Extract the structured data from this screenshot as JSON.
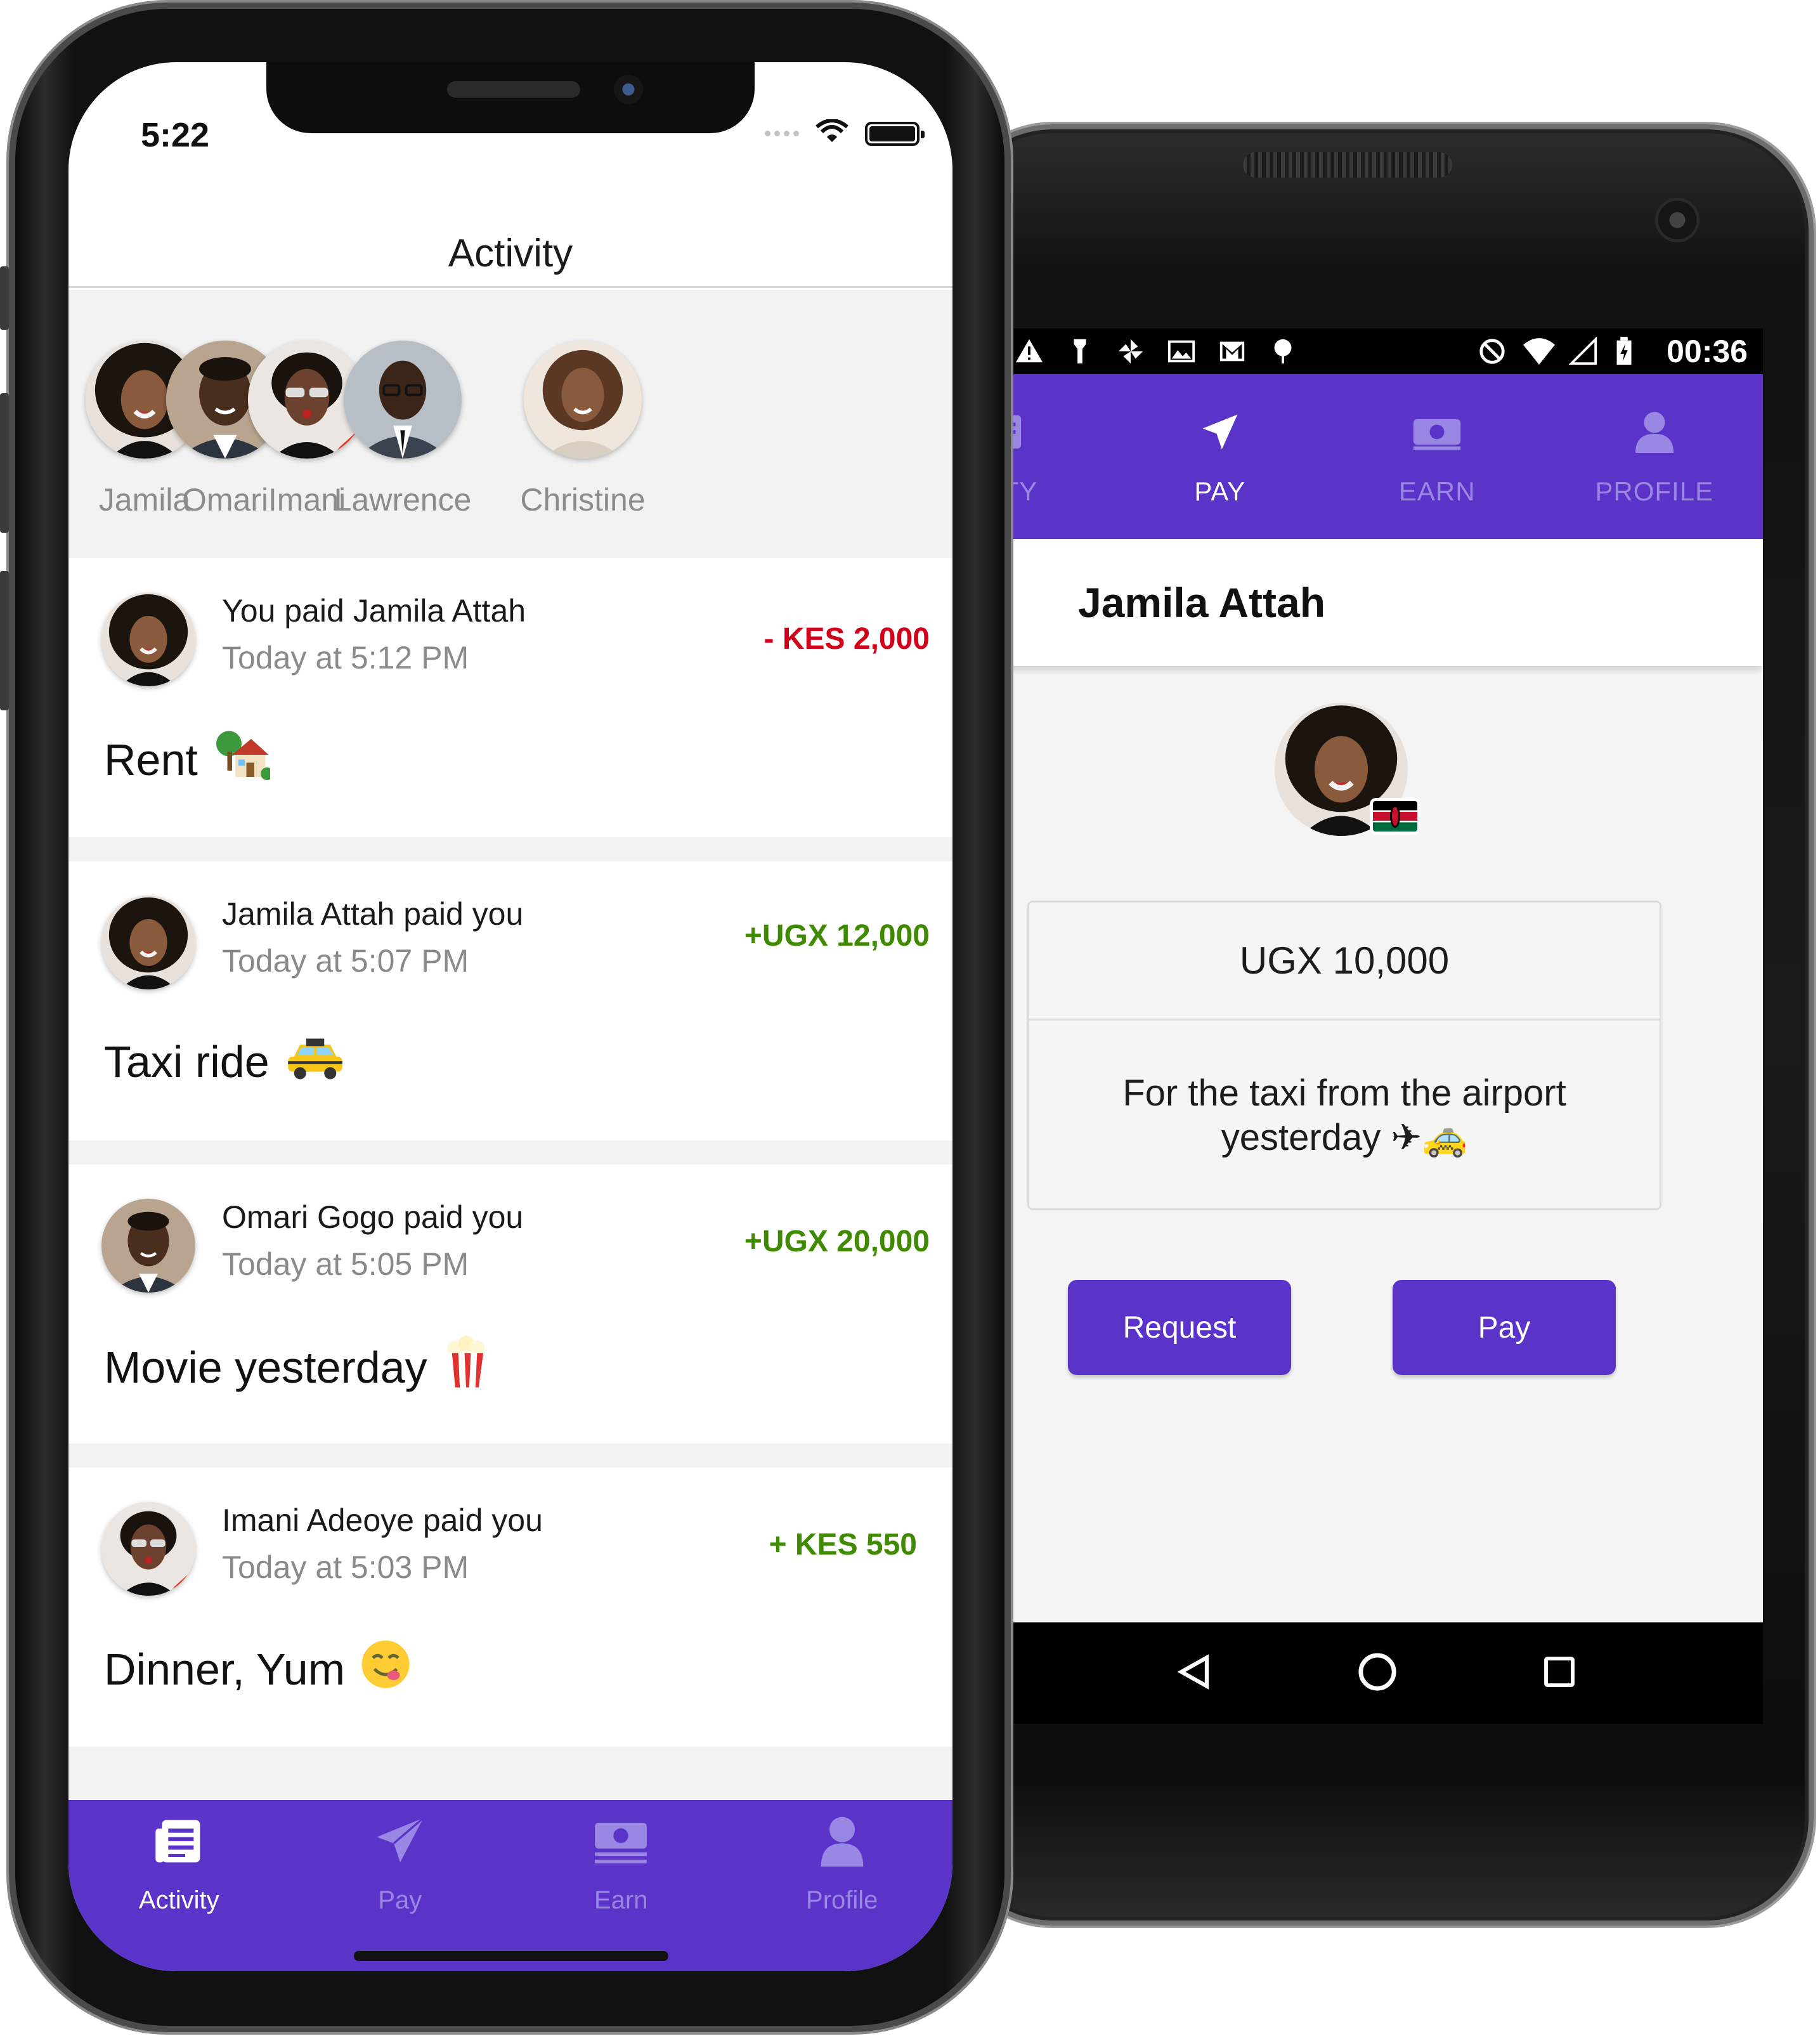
{
  "ios": {
    "status": {
      "time": "5:22"
    },
    "title": "Activity",
    "stories": [
      {
        "name": "Jamila"
      },
      {
        "name": "Omari"
      },
      {
        "name": "Imani"
      },
      {
        "name": "Lawrence"
      },
      {
        "name": "Christine"
      }
    ],
    "feed": [
      {
        "headline": "You paid Jamila Attah",
        "time": "Today at 5:12 PM",
        "amount": "- KES 2,000",
        "direction": "negative",
        "note": "Rent",
        "emoji": "house-with-garden"
      },
      {
        "headline": "Jamila Attah paid you",
        "time": "Today at 5:07 PM",
        "amount": "+UGX 12,000",
        "direction": "positive",
        "note": "Taxi ride",
        "emoji": "taxi"
      },
      {
        "headline": "Omari Gogo paid you",
        "time": "Today at 5:05 PM",
        "amount": "+UGX 20,000",
        "direction": "positive",
        "note": "Movie yesterday",
        "emoji": "popcorn"
      },
      {
        "headline": "Imani Adeoye paid you",
        "time": "Today at 5:03 PM",
        "amount": "+ KES 550",
        "direction": "positive",
        "note": "Dinner, Yum",
        "emoji": "yum-face"
      }
    ],
    "tabs": [
      {
        "label": "Activity",
        "icon": "newspaper-icon",
        "active": true
      },
      {
        "label": "Pay",
        "icon": "paper-plane-icon",
        "active": false
      },
      {
        "label": "Earn",
        "icon": "banknote-icon",
        "active": false
      },
      {
        "label": "Profile",
        "icon": "person-icon",
        "active": false
      }
    ]
  },
  "android": {
    "status": {
      "time": "00:36"
    },
    "tabs": [
      {
        "label": "IVITY",
        "icon": "newspaper-icon",
        "active": false
      },
      {
        "label": "PAY",
        "icon": "paper-plane-icon",
        "active": true
      },
      {
        "label": "EARN",
        "icon": "banknote-icon",
        "active": false
      },
      {
        "label": "PROFILE",
        "icon": "person-icon",
        "active": false
      }
    ],
    "recipient": "Jamila Attah",
    "flag": "kenya-flag",
    "amount": "UGX 10,000",
    "note": "For the taxi from the airport yesterday ✈🚕",
    "buttons": {
      "request": "Request",
      "pay": "Pay"
    }
  },
  "colors": {
    "brand_purple": "#5a34c9",
    "tab_inactive": "#9a86e3",
    "negative": "#d0021b",
    "positive": "#3f8a00"
  }
}
